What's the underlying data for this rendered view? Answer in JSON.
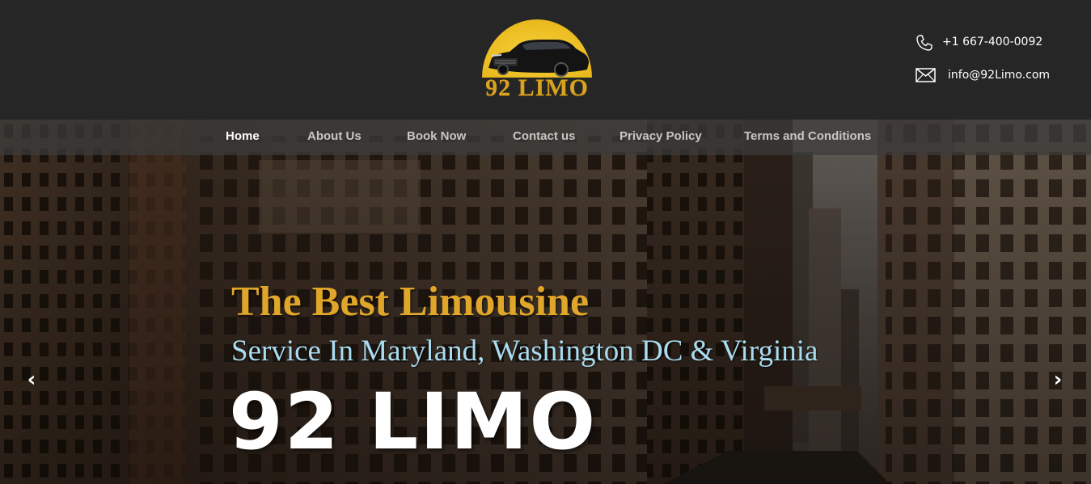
{
  "header": {
    "logo_text": "92 LIMO",
    "phone": "+1 667-400-0092",
    "email": "info@92Limo.com",
    "phone_icon": "phone-icon",
    "email_icon": "envelope-icon"
  },
  "nav": {
    "items": [
      {
        "label": "Home",
        "active": true
      },
      {
        "label": "About Us",
        "active": false
      },
      {
        "label": "Book Now",
        "active": false
      },
      {
        "label": "Contact us",
        "active": false
      },
      {
        "label": "Privacy Policy",
        "active": false
      },
      {
        "label": "Terms and Conditions",
        "active": false
      }
    ]
  },
  "hero": {
    "line1": "The Best Limousine",
    "line2": "Service In Maryland, Washington DC & Virginia",
    "line3": "92 LIMO",
    "prev_arrow": "‹",
    "next_arrow": "›"
  },
  "colors": {
    "header_bg": "#262626",
    "accent_gold": "#e0a62a",
    "subtitle_blue": "#a9dcf0",
    "text_white": "#ffffff"
  }
}
